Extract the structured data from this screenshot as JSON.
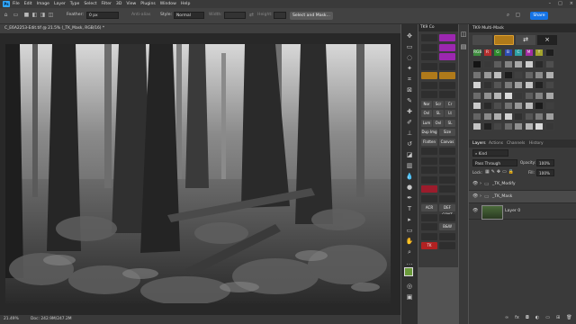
{
  "menubar": {
    "app_logo": "Ps",
    "menus": [
      "File",
      "Edit",
      "Image",
      "Layer",
      "Type",
      "Select",
      "Filter",
      "3D",
      "View",
      "Plugins",
      "Window",
      "Help"
    ],
    "window_controls": [
      "–",
      "□",
      "×"
    ]
  },
  "options_bar": {
    "feather_label": "Feather:",
    "feather_value": "0 px",
    "antialias_label": "Anti-alias",
    "style_label": "Style:",
    "style_value": "Normal",
    "width_label": "Width:",
    "height_label": "Height:",
    "select_mask_button": "Select and Mask...",
    "share_button": "Share"
  },
  "document": {
    "tab_title": "C_E6A2253-Edit.tif @ 21.5% (_TK_Mask, RGB/16) *",
    "zoom": "21.49%",
    "doc_info": "Doc: 242.9M/247.2M"
  },
  "tk_panel": {
    "title": "TK9 Co",
    "buttons": [
      {
        "label": "",
        "color": "#2e2e2e"
      },
      {
        "label": "",
        "color": "#9c27b0"
      },
      {
        "label": "",
        "color": "#2e2e2e"
      },
      {
        "label": "",
        "color": "#9c27b0"
      },
      {
        "label": "",
        "color": "#2e2e2e"
      },
      {
        "label": "",
        "color": "#9c27b0"
      },
      {
        "label": "",
        "color": "#2e2e2e"
      },
      {
        "label": "",
        "color": "#2e2e2e"
      },
      {
        "label": "",
        "color": "#b07a1a"
      },
      {
        "label": "",
        "color": "#b07a1a"
      },
      {
        "label": "",
        "color": "#2e2e2e"
      },
      {
        "label": "",
        "color": "#2e2e2e"
      },
      {
        "label": "",
        "color": "#2e2e2e"
      },
      {
        "label": "",
        "color": "#2e2e2e"
      },
      {
        "label": "Nor",
        "color": "#4a4a4a"
      },
      {
        "label": "Scr",
        "color": "#4a4a4a"
      },
      {
        "label": "Cr",
        "color": "#4a4a4a"
      },
      {
        "label": "Ovl",
        "color": "#4a4a4a"
      },
      {
        "label": "SL",
        "color": "#4a4a4a"
      },
      {
        "label": "Lt",
        "color": "#4a4a4a"
      },
      {
        "label": "Lum",
        "color": "#4a4a4a"
      },
      {
        "label": "Ovl",
        "color": "#4a4a4a"
      },
      {
        "label": "SL",
        "color": "#4a4a4a"
      },
      {
        "label": "Dup Img",
        "color": "#4a4a4a"
      },
      {
        "label": "Size",
        "color": "#4a4a4a"
      },
      {
        "label": "Flatten",
        "color": "#4a4a4a"
      },
      {
        "label": "Canvas",
        "color": "#4a4a4a"
      },
      {
        "label": "",
        "color": "#2e2e2e"
      },
      {
        "label": "",
        "color": "#2e2e2e"
      },
      {
        "label": "",
        "color": "#2e2e2e"
      },
      {
        "label": "",
        "color": "#2e2e2e"
      },
      {
        "label": "",
        "color": "#2e2e2e"
      },
      {
        "label": "",
        "color": "#2e2e2e"
      },
      {
        "label": "",
        "color": "#2e2e2e"
      },
      {
        "label": "",
        "color": "#2e2e2e"
      },
      {
        "label": "",
        "color": "#9c1c2c"
      },
      {
        "label": "",
        "color": "#2e2e2e"
      },
      {
        "label": "",
        "color": "#2e2e2e"
      },
      {
        "label": "",
        "color": "#2e2e2e"
      },
      {
        "label": "ACR",
        "color": "#4a4a4a"
      },
      {
        "label": "DEF CONT",
        "color": "#4a4a4a"
      },
      {
        "label": "",
        "color": "#2e2e2e"
      },
      {
        "label": "",
        "color": "#2e2e2e"
      },
      {
        "label": "",
        "color": "#2e2e2e"
      },
      {
        "label": "B&W",
        "color": "#4a4a4a"
      },
      {
        "label": "",
        "color": "#2e2e2e"
      },
      {
        "label": "",
        "color": "#2e2e2e"
      },
      {
        "label": "TK",
        "color": "#b22222"
      },
      {
        "label": "",
        "color": "#2e2e2e"
      }
    ]
  },
  "multimask": {
    "title": "TK9 Multi-Mask",
    "color_cells": [
      {
        "label": "RGB",
        "color": "#3e8c3e"
      },
      {
        "label": "R",
        "color": "#b32d2d"
      },
      {
        "label": "G",
        "color": "#2d8c2d"
      },
      {
        "label": "B",
        "color": "#2d4cb3"
      },
      {
        "label": "C",
        "color": "#2d9fa3"
      },
      {
        "label": "M",
        "color": "#a32da3"
      },
      {
        "label": "Y",
        "color": "#a3a32d"
      },
      {
        "label": "",
        "color": "#1e1e1e"
      }
    ]
  },
  "layers": {
    "tabs": [
      "Layers",
      "Actions",
      "Channels",
      "History"
    ],
    "filter_kind": "Kind",
    "blend_mode": "Pass Through",
    "opacity_label": "Opacity:",
    "opacity_value": "100%",
    "lock_label": "Lock:",
    "fill_label": "Fill:",
    "fill_value": "100%",
    "items": [
      {
        "name": "_TK_Modify",
        "type": "group"
      },
      {
        "name": "_TK_Mask",
        "type": "group"
      },
      {
        "name": "Layer 0",
        "type": "pixel"
      }
    ]
  },
  "colors": {
    "accent": "#31a8ff",
    "share": "#1473e6",
    "foreground_swatch": "#6a9a3a",
    "background_swatch": "#2f2f2f"
  }
}
